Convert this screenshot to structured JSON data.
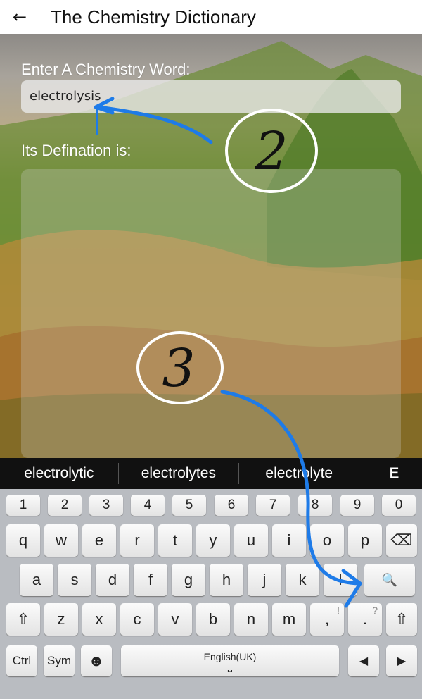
{
  "appbar": {
    "back_icon": "arrow-left-icon",
    "back_glyph": "←",
    "title": "The Chemistry Dictionary"
  },
  "form": {
    "prompt": "Enter A Chemistry Word:",
    "input_value": "electrolysis",
    "definition_label": "Its Defination is:",
    "definition_text": ""
  },
  "suggestions": [
    "electrolytic",
    "electrolytes",
    "electrolyte",
    "E"
  ],
  "keyboard": {
    "numbers": [
      "1",
      "2",
      "3",
      "4",
      "5",
      "6",
      "7",
      "8",
      "9",
      "0"
    ],
    "row1": [
      "q",
      "w",
      "e",
      "r",
      "t",
      "y",
      "u",
      "i",
      "o",
      "p"
    ],
    "row2": [
      "a",
      "s",
      "d",
      "f",
      "g",
      "h",
      "j",
      "k",
      "l"
    ],
    "row3": [
      "z",
      "x",
      "c",
      "v",
      "b",
      "n",
      "m"
    ],
    "comma": ",",
    "comma_alt": "!",
    "period": ".",
    "period_alt": "?",
    "shift_glyph": "⇧",
    "backspace_glyph": "⌫",
    "search_glyph": "🔍",
    "ctrl": "Ctrl",
    "sym": "Sym",
    "emoji_glyph": "☻",
    "space_label": "English(UK)",
    "space_glyph": "⎵",
    "left_glyph": "◀",
    "right_glyph": "▶"
  },
  "annotations": {
    "circle_2": "2",
    "circle_3": "3"
  }
}
